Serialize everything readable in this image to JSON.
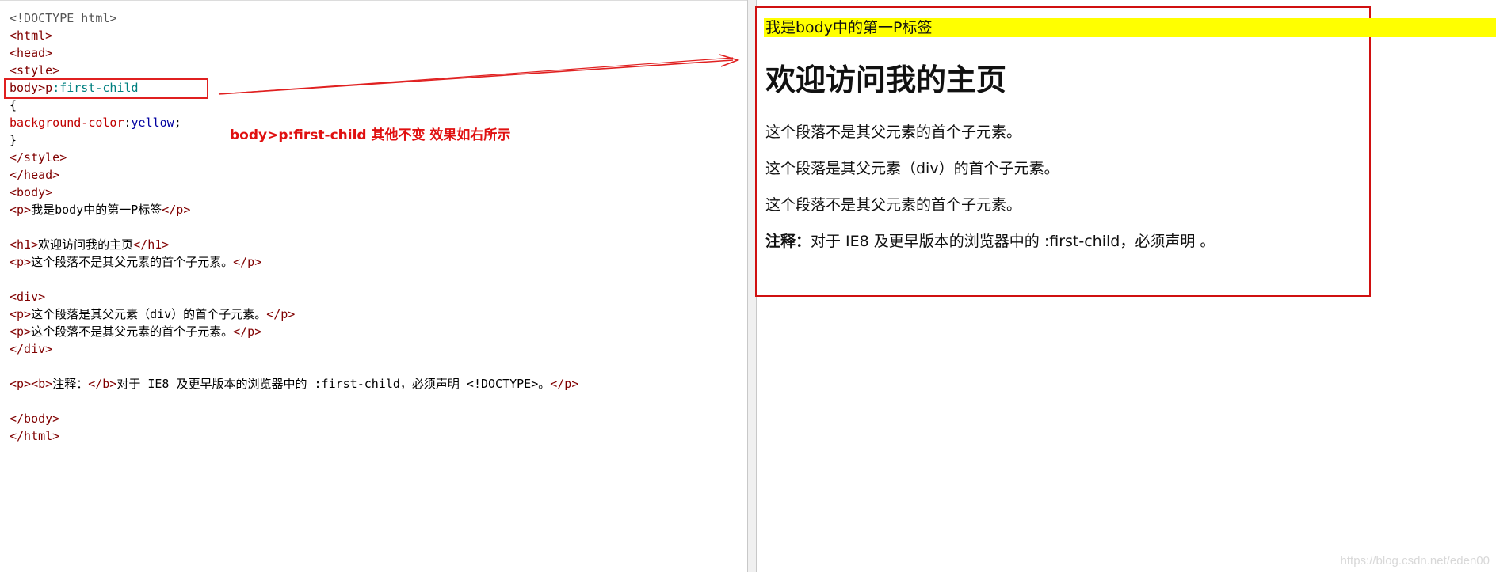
{
  "code_editor": {
    "lines": [
      {
        "parts": [
          {
            "c": "doc",
            "t": "<!DOCTYPE html>"
          }
        ]
      },
      {
        "parts": [
          {
            "c": "tg",
            "t": "<html>"
          }
        ]
      },
      {
        "parts": [
          {
            "c": "tg",
            "t": "<head>"
          }
        ]
      },
      {
        "parts": [
          {
            "c": "tg",
            "t": "<style>"
          }
        ]
      },
      {
        "parts": [
          {
            "c": "tg",
            "t": "body>"
          },
          {
            "c": "tg",
            "t": "p"
          },
          {
            "c": "sel",
            "t": ":first-child"
          }
        ]
      },
      {
        "parts": [
          {
            "c": "tx",
            "t": "{"
          }
        ]
      },
      {
        "parts": [
          {
            "c": "prop",
            "t": "background-color"
          },
          {
            "c": "tx",
            "t": ":"
          },
          {
            "c": "val",
            "t": "yellow"
          },
          {
            "c": "tx",
            "t": ";"
          }
        ]
      },
      {
        "parts": [
          {
            "c": "tx",
            "t": "}"
          }
        ]
      },
      {
        "parts": [
          {
            "c": "tg",
            "t": "</style>"
          }
        ]
      },
      {
        "parts": [
          {
            "c": "tg",
            "t": "</head>"
          }
        ]
      },
      {
        "parts": [
          {
            "c": "tg",
            "t": "<body>"
          }
        ]
      },
      {
        "parts": [
          {
            "c": "tg",
            "t": "<p>"
          },
          {
            "c": "tx",
            "t": "我是body中的第一P标签"
          },
          {
            "c": "tg",
            "t": "</p>"
          }
        ]
      },
      {
        "parts": []
      },
      {
        "parts": [
          {
            "c": "tg",
            "t": "<h1>"
          },
          {
            "c": "tx",
            "t": "欢迎访问我的主页"
          },
          {
            "c": "tg",
            "t": "</h1>"
          }
        ]
      },
      {
        "parts": [
          {
            "c": "tg",
            "t": "<p>"
          },
          {
            "c": "tx",
            "t": "这个段落不是其父元素的首个子元素。"
          },
          {
            "c": "tg",
            "t": "</p>"
          }
        ]
      },
      {
        "parts": []
      },
      {
        "parts": [
          {
            "c": "tg",
            "t": "<div>"
          }
        ]
      },
      {
        "parts": [
          {
            "c": "tg",
            "t": "<p>"
          },
          {
            "c": "tx",
            "t": "这个段落是其父元素（div）的首个子元素。"
          },
          {
            "c": "tg",
            "t": "</p>"
          }
        ]
      },
      {
        "parts": [
          {
            "c": "tg",
            "t": "<p>"
          },
          {
            "c": "tx",
            "t": "这个段落不是其父元素的首个子元素。"
          },
          {
            "c": "tg",
            "t": "</p>"
          }
        ]
      },
      {
        "parts": [
          {
            "c": "tg",
            "t": "</div>"
          }
        ]
      },
      {
        "parts": []
      },
      {
        "parts": [
          {
            "c": "tg",
            "t": "<p><b>"
          },
          {
            "c": "tx",
            "t": "注释："
          },
          {
            "c": "tg",
            "t": "</b>"
          },
          {
            "c": "tx",
            "t": "对于 IE8 及更早版本的浏览器中的 :first-child，必须声明 <!DOCTYPE>。"
          },
          {
            "c": "tg",
            "t": "</p>"
          }
        ]
      },
      {
        "parts": []
      },
      {
        "parts": [
          {
            "c": "tg",
            "t": "</body>"
          }
        ]
      },
      {
        "parts": [
          {
            "c": "tg",
            "t": "</html>"
          }
        ]
      }
    ]
  },
  "annotation": {
    "text": "body>p:first-child  其他不变  效果如右所示",
    "color": "#e01010"
  },
  "preview": {
    "first_p": "我是body中的第一P标签",
    "heading": "欢迎访问我的主页",
    "p1": "这个段落不是其父元素的首个子元素。",
    "p2": "这个段落是其父元素（div）的首个子元素。",
    "p3": "这个段落不是其父元素的首个子元素。",
    "note_label": "注释：",
    "note_text": "对于 IE8 及更早版本的浏览器中的 :first-child，必须声明 。",
    "highlight_color": "#ffff00"
  },
  "watermark": "https://blog.csdn.net/eden00"
}
